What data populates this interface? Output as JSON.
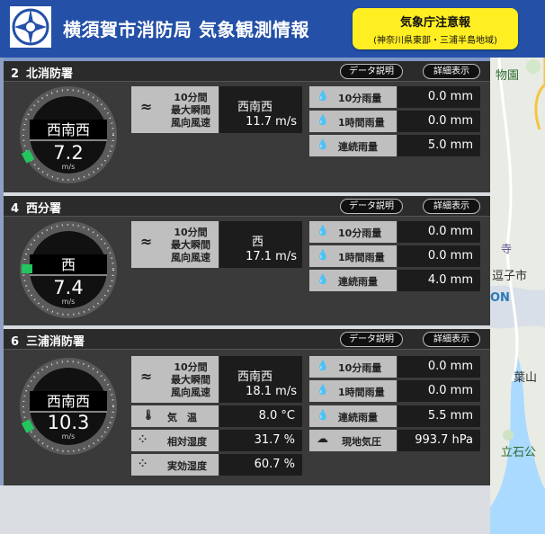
{
  "header": {
    "title": "横須賀市消防局 気象観測情報",
    "alert_title": "気象庁注意報",
    "alert_area": "(神奈川県東部・三浦半島地域)"
  },
  "map_labels": {
    "zoo": "物園",
    "temple": "寺",
    "station": "逗子市",
    "on": "ON",
    "hayama": "葉山",
    "park": "立石公"
  },
  "buttons": {
    "data_desc": "データ説明",
    "detail": "詳細表示"
  },
  "labels": {
    "wind": [
      "10分間",
      "最大瞬間",
      "風向風速"
    ],
    "rain10": "10分雨量",
    "rain1h": "1時間雨量",
    "rain_cont": "連続雨量",
    "temp": "気　温",
    "humidity": "相対湿度",
    "eff_humidity": "実効湿度",
    "pressure": "現地気圧"
  },
  "gauge_unit": "m/s",
  "stations": [
    {
      "number": "2",
      "name": "北消防署",
      "direction": "西南西",
      "speed": "7.2",
      "wind_dir": "西南西",
      "wind_speed": "11.7 m/s",
      "rain10": "0.0 mm",
      "rain1h": "0.0 mm",
      "rain_cont": "5.0 mm"
    },
    {
      "number": "4",
      "name": "西分署",
      "direction": "西",
      "speed": "7.4",
      "wind_dir": "西",
      "wind_speed": "17.1 m/s",
      "rain10": "0.0 mm",
      "rain1h": "0.0 mm",
      "rain_cont": "4.0 mm"
    },
    {
      "number": "6",
      "name": "三浦消防署",
      "direction": "西南西",
      "speed": "10.3",
      "wind_dir": "西南西",
      "wind_speed": "18.1 m/s",
      "rain10": "0.0 mm",
      "rain1h": "0.0 mm",
      "rain_cont": "5.5 mm",
      "temp": "8.0 °C",
      "humidity": "31.7 %",
      "eff_humidity": "60.7 %",
      "pressure": "993.7 hPa"
    }
  ],
  "colors": {
    "header_bg": "#2450a7",
    "alert_bg": "#ffee22",
    "gauge_marker": "#22c55e",
    "label_bg": "#bfbfbf",
    "value_bg": "#1c1c1c"
  }
}
